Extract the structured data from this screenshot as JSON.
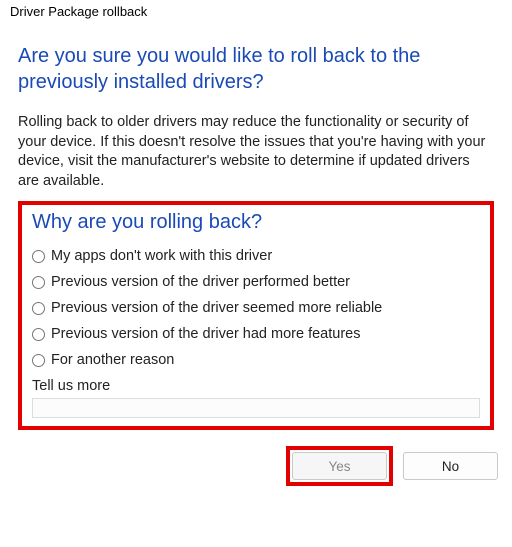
{
  "window": {
    "title": "Driver Package rollback"
  },
  "heading": "Are you sure you would like to roll back to the previously installed drivers?",
  "description": "Rolling back to older drivers may reduce the functionality or security of your device. If this doesn't resolve the issues that you're having with your device, visit the manufacturer's website to determine if updated drivers are available.",
  "subheading": "Why are you rolling back?",
  "reasons": [
    "My apps don't work with this driver",
    "Previous version of the driver performed better",
    "Previous version of the driver seemed more reliable",
    "Previous version of the driver had more features",
    "For another reason"
  ],
  "tellUsLabel": "Tell us more",
  "tellUsValue": "",
  "buttons": {
    "yes": "Yes",
    "no": "No"
  },
  "highlightColor": "#e20000"
}
